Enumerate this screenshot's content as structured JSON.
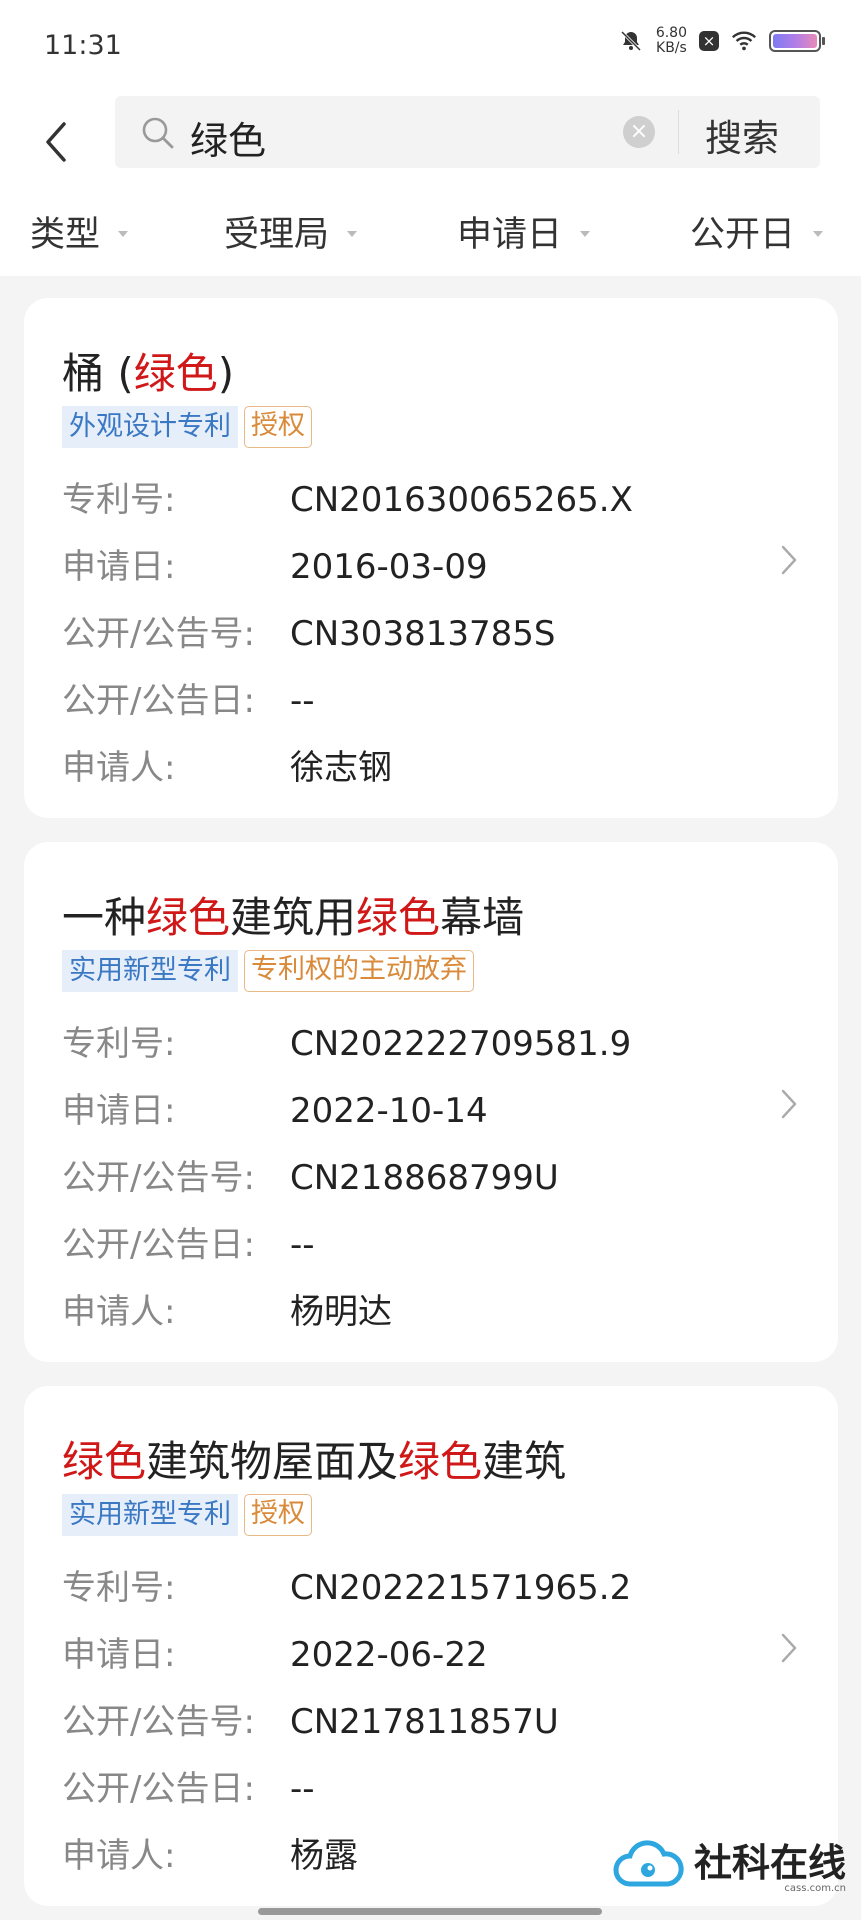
{
  "status": {
    "time": "11:31",
    "net_speed_value": "6.80",
    "net_speed_unit": "KB/s",
    "icons": [
      "bell-off-icon",
      "close-box-icon",
      "wifi-icon",
      "battery-icon"
    ]
  },
  "header": {
    "search_query": "绿色",
    "search_button": "搜索"
  },
  "filters": [
    {
      "label": "类型"
    },
    {
      "label": "受理局"
    },
    {
      "label": "申请日"
    },
    {
      "label": "公开日"
    }
  ],
  "labels": {
    "patent_no": "专利号:",
    "apply_date": "申请日:",
    "pub_no": "公开/公告号:",
    "pub_date": "公开/公告日:",
    "applicant": "申请人:"
  },
  "results": [
    {
      "title_parts": [
        {
          "text": "桶 (",
          "hl": false
        },
        {
          "text": "绿色",
          "hl": true
        },
        {
          "text": ")",
          "hl": false
        }
      ],
      "type_tag": "外观设计专利",
      "status_tag": "授权",
      "patent_no": "CN201630065265.X",
      "apply_date": "2016-03-09",
      "pub_no": "CN303813785S",
      "pub_date": "--",
      "applicant": "徐志钢"
    },
    {
      "title_parts": [
        {
          "text": "一种",
          "hl": false
        },
        {
          "text": "绿色",
          "hl": true
        },
        {
          "text": "建筑用",
          "hl": false
        },
        {
          "text": "绿色",
          "hl": true
        },
        {
          "text": "幕墙",
          "hl": false
        }
      ],
      "type_tag": "实用新型专利",
      "status_tag": "专利权的主动放弃",
      "patent_no": "CN202222709581.9",
      "apply_date": "2022-10-14",
      "pub_no": "CN218868799U",
      "pub_date": "--",
      "applicant": "杨明达"
    },
    {
      "title_parts": [
        {
          "text": "绿色",
          "hl": true
        },
        {
          "text": "建筑物屋面及",
          "hl": false
        },
        {
          "text": "绿色",
          "hl": true
        },
        {
          "text": "建筑",
          "hl": false
        }
      ],
      "type_tag": "实用新型专利",
      "status_tag": "授权",
      "patent_no": "CN202221571965.2",
      "apply_date": "2022-06-22",
      "pub_no": "CN217811857U",
      "pub_date": "--",
      "applicant": "杨露"
    }
  ],
  "watermark": {
    "text": "社科在线",
    "url": "cass.com.cn"
  },
  "colors": {
    "highlight": "#d01818",
    "type_tag": "#3a78c4",
    "status_tag": "#d98a3a"
  }
}
